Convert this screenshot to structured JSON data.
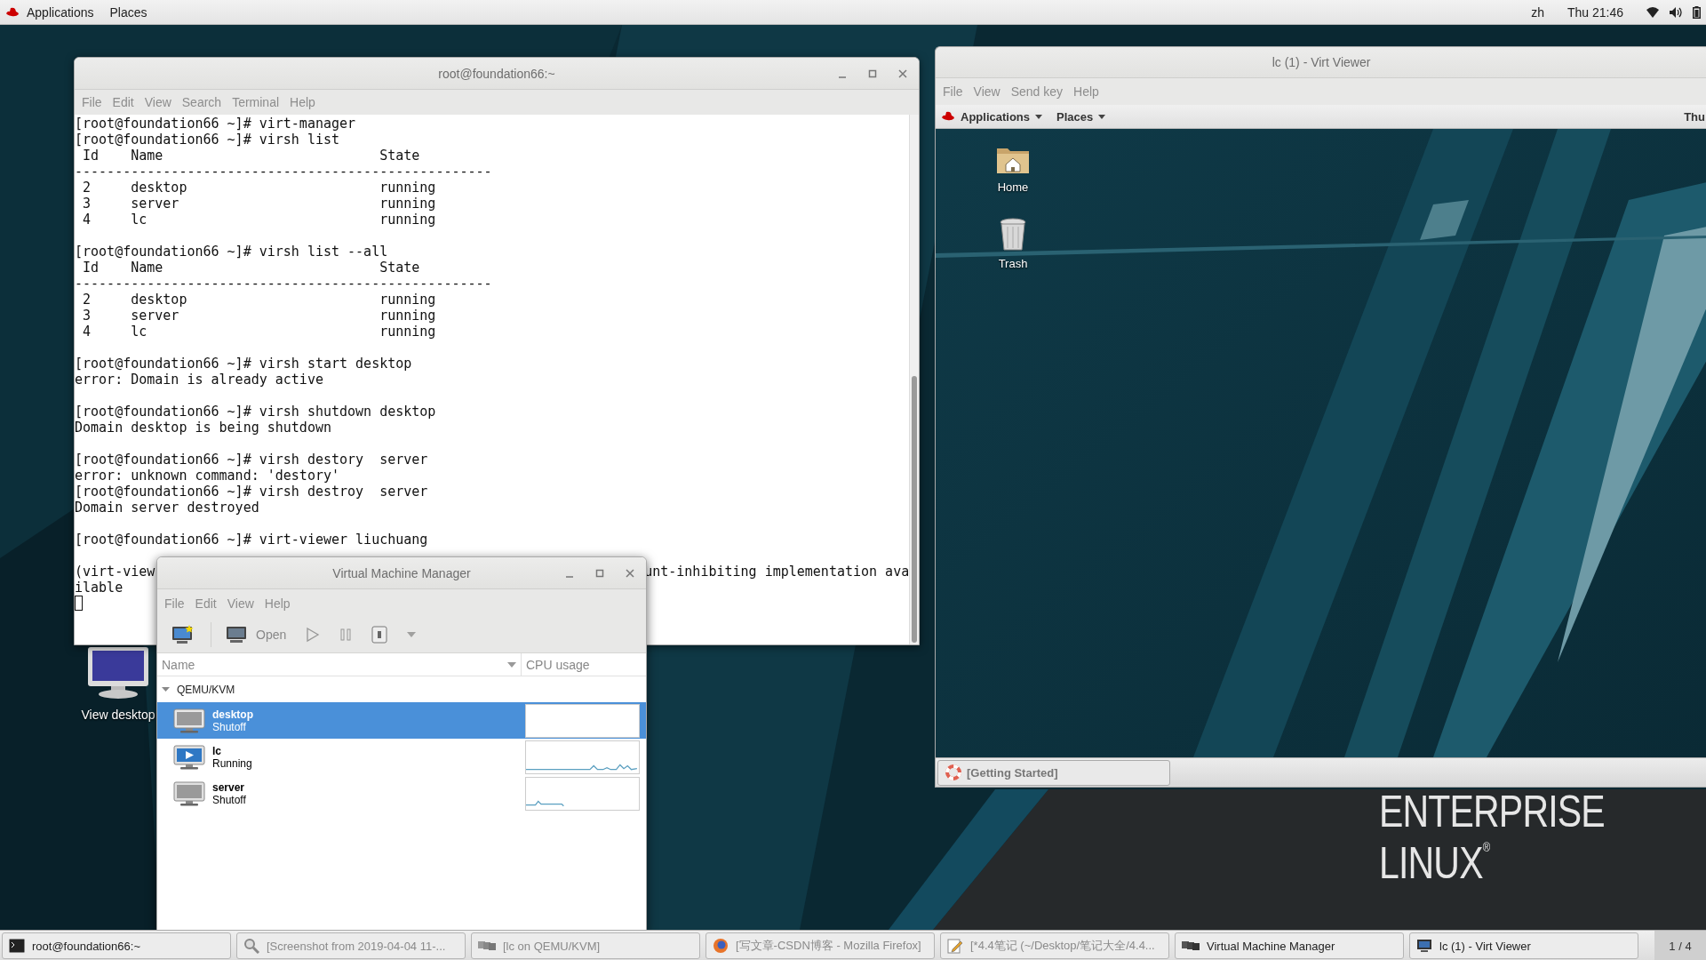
{
  "top_bar": {
    "menus": [
      "Applications",
      "Places"
    ],
    "language": "zh",
    "clock": "Thu 21:46"
  },
  "desktop_icons": [
    {
      "label": "View desktop"
    }
  ],
  "wallpaper_text": [
    "ENTERPRISE",
    "LINUX$^{®}$"
  ],
  "terminal": {
    "title": "root@foundation66:~",
    "menus": [
      "File",
      "Edit",
      "View",
      "Search",
      "Terminal",
      "Help"
    ],
    "lines": [
      {
        "kind": "text",
        "text": "[root@foundation66 ~]# virt-manager"
      },
      {
        "kind": "text",
        "text": "[root@foundation66 ~]# virsh list"
      },
      {
        "kind": "text",
        "text": " Id    Name                           State"
      },
      {
        "kind": "text",
        "text": "----------------------------------------------------"
      },
      {
        "kind": "text",
        "text": " 2     desktop                        running"
      },
      {
        "kind": "text",
        "text": " 3     server                         running"
      },
      {
        "kind": "text",
        "text": " 4     lc                             running"
      },
      {
        "kind": "blank"
      },
      {
        "kind": "text",
        "text": "[root@foundation66 ~]# virsh list --all"
      },
      {
        "kind": "text",
        "text": " Id    Name                           State"
      },
      {
        "kind": "text",
        "text": "----------------------------------------------------"
      },
      {
        "kind": "text",
        "text": " 2     desktop                        running"
      },
      {
        "kind": "text",
        "text": " 3     server                         running"
      },
      {
        "kind": "text",
        "text": " 4     lc                             running"
      },
      {
        "kind": "blank"
      },
      {
        "kind": "text",
        "text": "[root@foundation66 ~]# virsh start desktop"
      },
      {
        "kind": "text",
        "text": "error: Domain is already active"
      },
      {
        "kind": "blank"
      },
      {
        "kind": "text",
        "text": "[root@foundation66 ~]# virsh shutdown desktop"
      },
      {
        "kind": "text",
        "text": "Domain desktop is being shutdown"
      },
      {
        "kind": "blank"
      },
      {
        "kind": "text",
        "text": "[root@foundation66 ~]# virsh destory  server"
      },
      {
        "kind": "text",
        "text": "error: unknown command: 'destory'"
      },
      {
        "kind": "text",
        "text": "[root@foundation66 ~]# virsh destroy  server"
      },
      {
        "kind": "text",
        "text": "Domain server destroyed"
      },
      {
        "kind": "blank"
      },
      {
        "kind": "text",
        "text": "[root@foundation66 ~]# virt-viewer liuchuang"
      },
      {
        "kind": "blank"
      },
      {
        "kind": "split",
        "left": "(virt-view",
        "right": "unt-inhibiting implementation ava"
      },
      {
        "kind": "text",
        "text": "ilable"
      },
      {
        "kind": "cursor"
      }
    ]
  },
  "vmm": {
    "title": "Virtual Machine Manager",
    "menus": [
      "File",
      "Edit",
      "View",
      "Help"
    ],
    "toolbar": [
      {
        "kind": "new",
        "disabled": false
      },
      {
        "kind": "open",
        "label": "Open",
        "disabled": false
      },
      {
        "kind": "run",
        "disabled": true
      },
      {
        "kind": "pause",
        "disabled": true
      },
      {
        "kind": "stop",
        "disabled": false
      },
      {
        "kind": "menu",
        "disabled": true
      }
    ],
    "columns": [
      "Name",
      "CPU usage"
    ],
    "group": {
      "label": "QEMU/KVM",
      "expanded": true
    },
    "vms": [
      {
        "name": "desktop",
        "status": "Shutoff",
        "running": false,
        "selected": true
      },
      {
        "name": "lc",
        "status": "Running",
        "running": true,
        "selected": false
      },
      {
        "name": "server",
        "status": "Shutoff",
        "running": false,
        "selected": false
      }
    ]
  },
  "viewer": {
    "title": "lc (1) - Virt Viewer",
    "menus": [
      "File",
      "View",
      "Send key",
      "Help"
    ],
    "guest": {
      "menus": [
        "Applications",
        "Places"
      ],
      "clock": "Thu",
      "icons": [
        {
          "kind": "folder",
          "label": "Home"
        },
        {
          "kind": "trash",
          "label": "Trash"
        }
      ],
      "tasks": [
        "[Getting Started]"
      ]
    }
  },
  "taskbar": {
    "items": [
      {
        "kind": "terminal",
        "label": "root@foundation66:~",
        "minimized": false
      },
      {
        "kind": "screenshot",
        "label": "[Screenshot from 2019-04-04 11-...",
        "minimized": true
      },
      {
        "kind": "vm",
        "label": "[lc on QEMU/KVM]",
        "minimized": true
      },
      {
        "kind": "firefox",
        "label": "[写文章-CSDN博客 - Mozilla Firefox]",
        "minimized": true
      },
      {
        "kind": "editor",
        "label": "[*4.4笔记 (~/Desktop/笔记大全/4.4...",
        "minimized": true
      },
      {
        "kind": "vmm",
        "label": "Virtual Machine Manager",
        "minimized": false
      },
      {
        "kind": "viewer",
        "label": "lc (1) - Virt Viewer",
        "minimized": false
      }
    ],
    "workspace": "1 / 4"
  }
}
